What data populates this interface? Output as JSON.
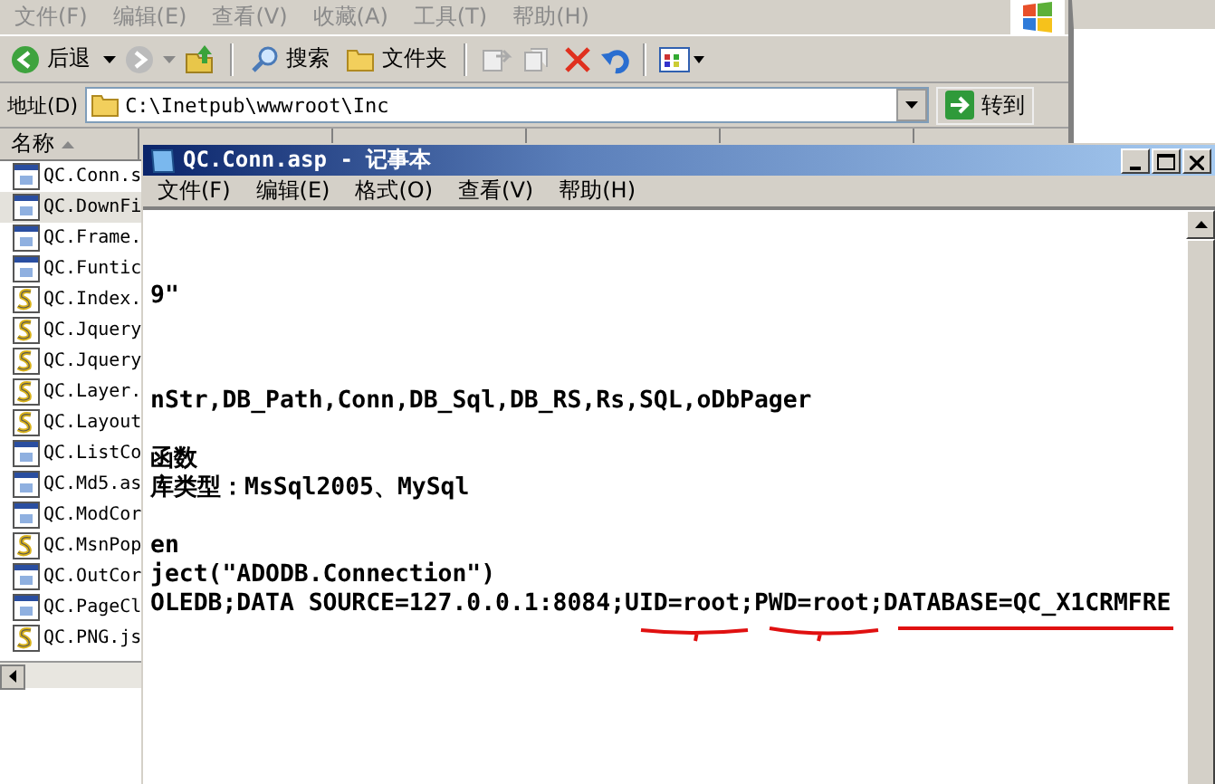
{
  "explorer": {
    "menu": [
      "文件(F)",
      "编辑(E)",
      "查看(V)",
      "收藏(A)",
      "工具(T)",
      "帮助(H)"
    ],
    "toolbar": {
      "back": "后退",
      "search": "搜索",
      "folders": "文件夹"
    },
    "address": {
      "label": "地址(D)",
      "value": "C:\\Inetpub\\wwwroot\\Inc",
      "go": "转到"
    },
    "columns": [
      "名称"
    ],
    "files": [
      {
        "name": "QC.Conn.s",
        "kind": "page",
        "selected": false
      },
      {
        "name": "QC.DownFi",
        "kind": "page",
        "selected": true
      },
      {
        "name": "QC.Frame.",
        "kind": "page",
        "selected": false
      },
      {
        "name": "QC.Funtic",
        "kind": "page",
        "selected": false
      },
      {
        "name": "QC.Index.",
        "kind": "script",
        "selected": false
      },
      {
        "name": "QC.Jquery",
        "kind": "script",
        "selected": false
      },
      {
        "name": "QC.Jquery",
        "kind": "script",
        "selected": false
      },
      {
        "name": "QC.Layer.",
        "kind": "script",
        "selected": false
      },
      {
        "name": "QC.Layout",
        "kind": "script",
        "selected": false
      },
      {
        "name": "QC.ListCo",
        "kind": "page",
        "selected": false
      },
      {
        "name": "QC.Md5.as",
        "kind": "page",
        "selected": false
      },
      {
        "name": "QC.ModCor",
        "kind": "page",
        "selected": false
      },
      {
        "name": "QC.MsnPop",
        "kind": "script",
        "selected": false
      },
      {
        "name": "QC.OutCor",
        "kind": "page",
        "selected": false
      },
      {
        "name": "QC.PageCl",
        "kind": "page",
        "selected": false
      },
      {
        "name": "QC.PNG.js",
        "kind": "script",
        "selected": false
      }
    ]
  },
  "notepad": {
    "title": "QC.Conn.asp - 记事本",
    "menu": [
      "文件(F)",
      "编辑(E)",
      "格式(O)",
      "查看(V)",
      "帮助(H)"
    ],
    "paragraphs": [
      [
        "9\""
      ],
      [
        "nStr,DB_Path,Conn,DB_Sql,DB_RS,Rs,SQL,oDbPager"
      ],
      [
        "函数",
        "库类型：MsSql2005、MySql"
      ],
      [
        "en",
        "ject(\"ADODB.Connection\")",
        "OLEDB;DATA SOURCE=127.0.0.1:8084;UID=root;PWD=root;DATABASE=QC_X1CRMFRE"
      ]
    ]
  }
}
